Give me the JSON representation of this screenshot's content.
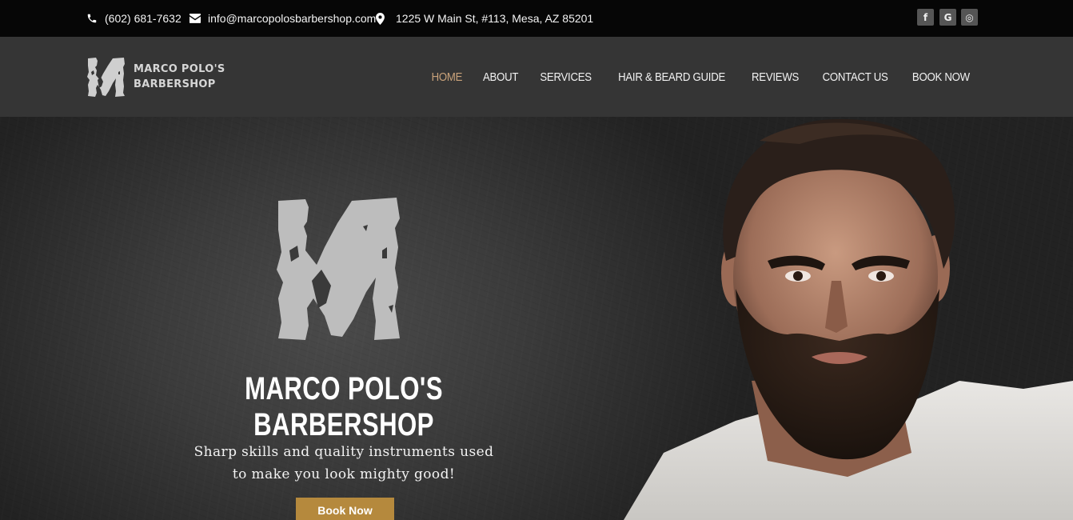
{
  "topbar": {
    "phone": "(602) 681-7632",
    "email": "info@marcopolosbarbershop.com",
    "address": "1225 W Main St, #113, Mesa, AZ 85201",
    "social": [
      {
        "icon": "facebook-icon",
        "glyph": "f"
      },
      {
        "icon": "google-icon",
        "glyph": "G"
      },
      {
        "icon": "instagram-icon",
        "glyph": "◎"
      }
    ]
  },
  "header": {
    "logo_line1": "MARCO POLO'S",
    "logo_line2": "BARBERSHOP",
    "nav": [
      {
        "label": "HOME",
        "active": true
      },
      {
        "label": "ABOUT"
      },
      {
        "label": "SERVICES"
      },
      {
        "label": "HAIR & BEARD GUIDE"
      },
      {
        "label": "REVIEWS"
      },
      {
        "label": "CONTACT US"
      },
      {
        "label": "BOOK NOW"
      }
    ]
  },
  "hero": {
    "title": "MARCO POLO'S BARBERSHOP",
    "subtitle_line1": "Sharp skills and quality instruments used",
    "subtitle_line2": "to make you look mighty good!",
    "cta": "Book Now"
  },
  "colors": {
    "topbar_bg": "#060606",
    "header_bg": "#353535",
    "nav_active": "#c9a27a",
    "cta_bg": "#b5893d"
  }
}
